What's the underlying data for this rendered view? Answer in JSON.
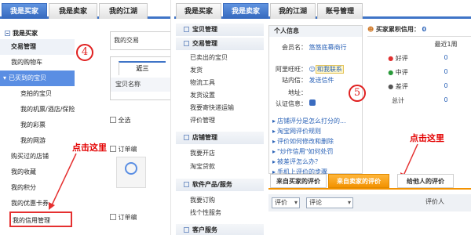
{
  "left": {
    "tabs": [
      "我是买家",
      "我是卖家",
      "我的江湖"
    ],
    "section_title": "我是买家",
    "menu": [
      {
        "label": "交易管理",
        "kind": "group"
      },
      {
        "label": "我的购物车",
        "kind": "item"
      },
      {
        "label": "已买到的宝贝",
        "kind": "selected"
      },
      {
        "label": "竞拍的宝贝",
        "kind": "sub"
      },
      {
        "label": "我的机票/酒店/保险",
        "kind": "sub"
      },
      {
        "label": "我的彩票",
        "kind": "sub"
      },
      {
        "label": "我的网游",
        "kind": "sub"
      },
      {
        "label": "购买过的店铺",
        "kind": "item"
      },
      {
        "label": "我的收藏",
        "kind": "item"
      },
      {
        "label": "我的积分",
        "kind": "item"
      },
      {
        "label": "我的优惠卡券",
        "kind": "item"
      },
      {
        "label": "我的信用管理",
        "kind": "target"
      }
    ],
    "step_number": "4",
    "click_here": "点击这里",
    "fragment_text": "我的交易",
    "recent_tab": "近三",
    "item_name_col": "宝贝名称",
    "select_all": "全选",
    "order_label": "订单编"
  },
  "right": {
    "tabs": [
      "我是买家",
      "我是卖家",
      "我的江湖",
      "账号管理"
    ],
    "left_menu": {
      "sections": [
        {
          "title": "宝贝管理",
          "items": []
        },
        {
          "title": "交易管理",
          "items": [
            "已卖出的宝贝",
            "发货",
            "物流工具",
            "发货设置",
            "我要寄快递运输",
            "评价管理"
          ]
        },
        {
          "title": "店铺管理",
          "items": [
            "我要开店",
            "淘宝贷款"
          ]
        },
        {
          "title": "软件产品/服务",
          "items": [
            "我要订购",
            "找个性服务"
          ]
        },
        {
          "title": "客户服务",
          "items": []
        }
      ]
    },
    "personal_info": {
      "title": "个人信息",
      "rows": [
        {
          "label": "会员名：",
          "value": "悠悠底幕商行"
        },
        {
          "label": "阿里旺旺：",
          "value": "和我联系"
        },
        {
          "label": "站内信：",
          "value": "发送信件"
        },
        {
          "label": "地址：",
          "value": ""
        },
        {
          "label": "认证信息：",
          "value": ""
        }
      ],
      "step_number": "5"
    },
    "links": [
      "店铺评分是怎么打分的...",
      "淘宝网评价规则",
      "评价如何修改和删除",
      "\"炒作信用\"如何处罚",
      "被差评怎么办？",
      "手机上评价的步骤"
    ],
    "credit": {
      "title": "买家累积信用：",
      "score": "0",
      "period_header": "最近1周",
      "rows": [
        {
          "label": "好评",
          "value": "0"
        },
        {
          "label": "中评",
          "value": "0"
        },
        {
          "label": "差评",
          "value": "0"
        },
        {
          "label": "总计",
          "value": "0"
        }
      ]
    },
    "click_here": "点击这里",
    "review_tabs": [
      "来自买家的评价",
      "来自卖家的评价",
      "给他人的评价"
    ],
    "filter_selects": [
      "评价",
      "评论"
    ],
    "evaluator_col": "评价人"
  }
}
